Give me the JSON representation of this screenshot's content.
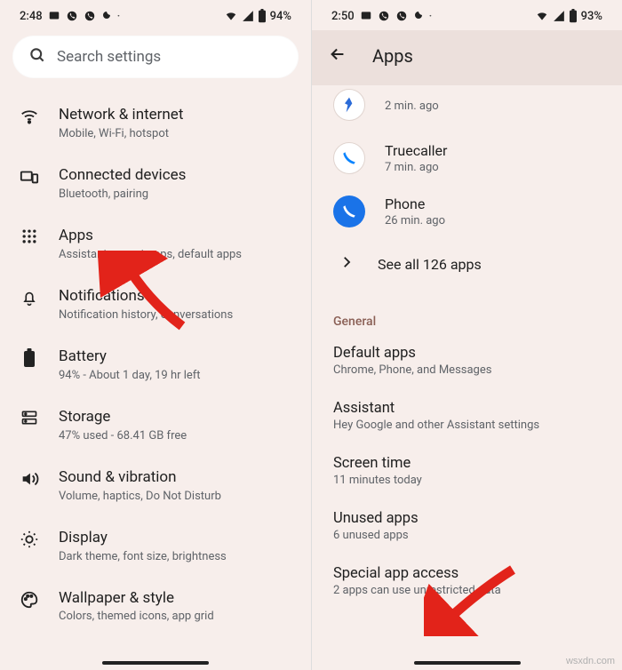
{
  "left": {
    "status": {
      "time": "2:48",
      "battery": "94%"
    },
    "search_placeholder": "Search settings",
    "items": [
      {
        "title": "Network & internet",
        "sub": "Mobile, Wi-Fi, hotspot"
      },
      {
        "title": "Connected devices",
        "sub": "Bluetooth, pairing"
      },
      {
        "title": "Apps",
        "sub": "Assistant, recent apps, default apps"
      },
      {
        "title": "Notifications",
        "sub": "Notification history, conversations"
      },
      {
        "title": "Battery",
        "sub": "94% - About 1 day, 19 hr left"
      },
      {
        "title": "Storage",
        "sub": "47% used - 68.41 GB free"
      },
      {
        "title": "Sound & vibration",
        "sub": "Volume, haptics, Do Not Disturb"
      },
      {
        "title": "Display",
        "sub": "Dark theme, font size, brightness"
      },
      {
        "title": "Wallpaper & style",
        "sub": "Colors, themed icons, app grid"
      }
    ]
  },
  "right": {
    "status": {
      "time": "2:50",
      "battery": "93%"
    },
    "page_title": "Apps",
    "recent": [
      {
        "name": "",
        "sub": "2 min. ago",
        "color": "#ffffff"
      },
      {
        "name": "Truecaller",
        "sub": "7 min. ago",
        "color": "#1a73e8"
      },
      {
        "name": "Phone",
        "sub": "26 min. ago",
        "color": "#1a73e8"
      }
    ],
    "see_all": "See all 126 apps",
    "section": "General",
    "general": [
      {
        "title": "Default apps",
        "sub": "Chrome, Phone, and Messages"
      },
      {
        "title": "Assistant",
        "sub": "Hey Google and other Assistant settings"
      },
      {
        "title": "Screen time",
        "sub": "11 minutes today"
      },
      {
        "title": "Unused apps",
        "sub": "6 unused apps"
      },
      {
        "title": "Special app access",
        "sub": "2 apps can use unrestricted data"
      }
    ]
  },
  "watermark": "wsxdn.com"
}
